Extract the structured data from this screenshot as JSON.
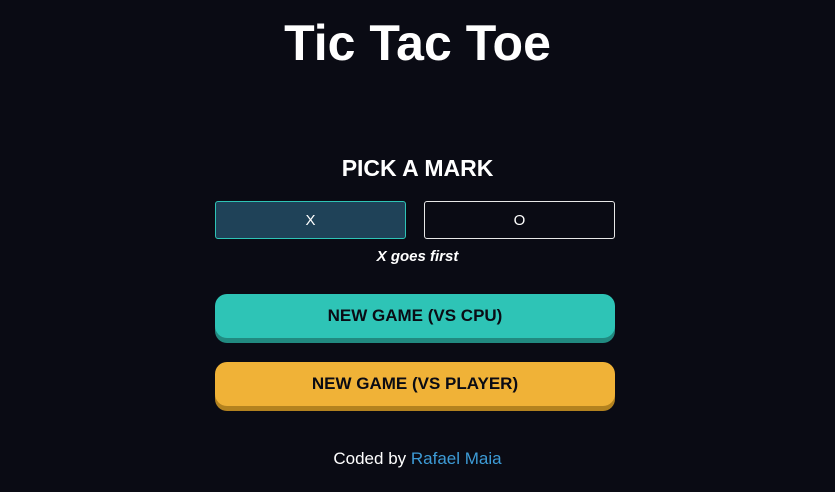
{
  "title": "Tic Tac Toe",
  "pick_label": "PICK A MARK",
  "marks": {
    "x": "X",
    "o": "O",
    "selected": "X"
  },
  "first_note": "X goes first",
  "buttons": {
    "cpu": "NEW GAME (VS CPU)",
    "player": "NEW GAME (VS PLAYER)"
  },
  "footer": {
    "prefix": "Coded by",
    "author": "Rafael Maia"
  },
  "colors": {
    "background": "#0a0b14",
    "teal": "#2ec4b6",
    "yellow": "#f0b237",
    "link": "#3d9bd6"
  }
}
